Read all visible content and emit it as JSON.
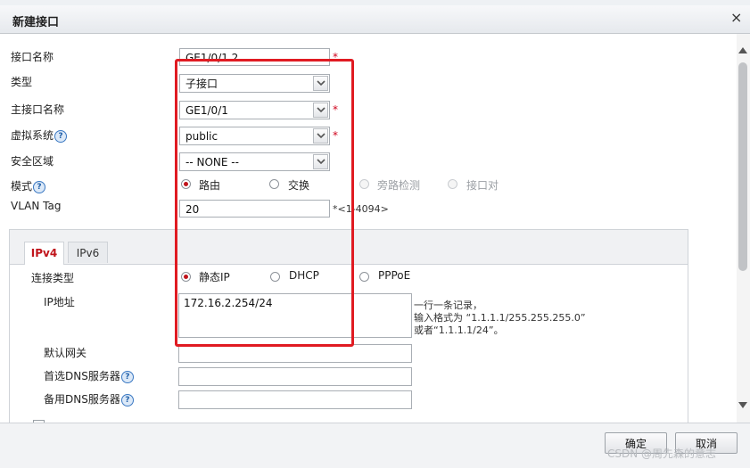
{
  "dialog": {
    "title": "新建接口",
    "close_glyph": "×"
  },
  "fields": {
    "interface_name": {
      "label": "接口名称",
      "value": "GE1/0/1.2",
      "required": "*"
    },
    "type": {
      "label": "类型",
      "value": "子接口"
    },
    "parent_interface": {
      "label": "主接口名称",
      "value": "GE1/0/1",
      "required": "*"
    },
    "virtual_system": {
      "label": "虚拟系统",
      "help": "?",
      "value": "public",
      "required": "*"
    },
    "security_zone": {
      "label": "安全区域",
      "value": "-- NONE --"
    },
    "mode": {
      "label": "模式",
      "help": "?",
      "options": [
        "路由",
        "交换",
        "旁路检测",
        "接口对"
      ],
      "selected": "路由"
    },
    "vlan_tag": {
      "label": "VLAN Tag",
      "value": "20",
      "hint": "*<1-4094>"
    }
  },
  "ip_panel": {
    "tabs": [
      "IPv4",
      "IPv6"
    ],
    "active_tab": "IPv4",
    "connection_type": {
      "label": "连接类型",
      "options": [
        "静态IP",
        "DHCP",
        "PPPoE"
      ],
      "selected": "静态IP"
    },
    "ip_address": {
      "label": "IP地址",
      "value": "172.16.2.254/24",
      "hint_line1": "一行一条记录，",
      "hint_line2": "输入格式为 “1.1.1.1/255.255.255.0”",
      "hint_line3": "或者“1.1.1.1/24”。"
    },
    "default_gateway": {
      "label": "默认网关",
      "value": ""
    },
    "primary_dns": {
      "label": "首选DNS服务器",
      "help": "?",
      "value": ""
    },
    "secondary_dns": {
      "label": "备用DNS服务器",
      "help": "?",
      "value": ""
    }
  },
  "footer": {
    "ok_label": "确定",
    "cancel_label": "取消"
  },
  "watermark": "CSDN @周先森的意志",
  "colors": {
    "accent_red": "#c0141b",
    "highlight_box": "#e01b22"
  }
}
